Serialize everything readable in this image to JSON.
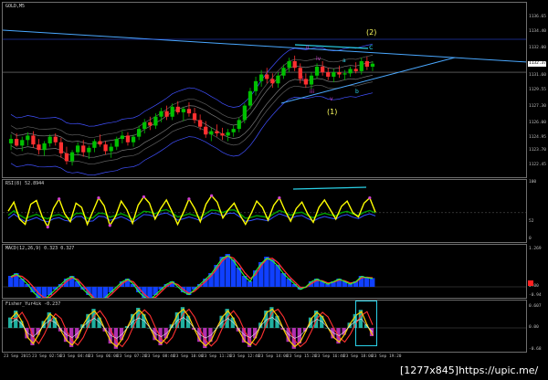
{
  "chart": {
    "symbol_title": "GOLD,M5",
    "price_scale": [
      "1136.65",
      "1134.40",
      "1132.00",
      "1131.60",
      "1129.55",
      "1127.30",
      "1126.00",
      "1124.95",
      "1123.70",
      "1122.45"
    ],
    "current_price": "1132.37",
    "wave_labels": {
      "big2": "(2)",
      "c": "c",
      "b": "b",
      "a": "a",
      "ii": "ii",
      "iii": "iii",
      "iv": "iv",
      "v": "v",
      "i": "i",
      "big1": "(1)"
    },
    "ohlc": [
      {
        "t": 0,
        "o": 1125.2,
        "h": 1126.0,
        "l": 1124.6,
        "c": 1125.6
      },
      {
        "t": 1,
        "o": 1125.6,
        "h": 1126.1,
        "l": 1124.9,
        "c": 1125.0
      },
      {
        "t": 2,
        "o": 1125.0,
        "h": 1125.8,
        "l": 1124.5,
        "c": 1125.5
      },
      {
        "t": 3,
        "o": 1125.5,
        "h": 1126.2,
        "l": 1125.0,
        "c": 1125.9
      },
      {
        "t": 4,
        "o": 1125.9,
        "h": 1126.3,
        "l": 1124.8,
        "c": 1125.1
      },
      {
        "t": 5,
        "o": 1125.1,
        "h": 1125.6,
        "l": 1124.2,
        "c": 1124.6
      },
      {
        "t": 6,
        "o": 1124.6,
        "h": 1125.4,
        "l": 1124.1,
        "c": 1125.2
      },
      {
        "t": 7,
        "o": 1125.2,
        "h": 1126.0,
        "l": 1124.9,
        "c": 1125.8
      },
      {
        "t": 8,
        "o": 1125.8,
        "h": 1126.1,
        "l": 1125.0,
        "c": 1125.3
      },
      {
        "t": 9,
        "o": 1125.3,
        "h": 1125.7,
        "l": 1123.9,
        "c": 1124.3
      },
      {
        "t": 10,
        "o": 1124.3,
        "h": 1124.9,
        "l": 1123.3,
        "c": 1123.6
      },
      {
        "t": 11,
        "o": 1123.6,
        "h": 1124.6,
        "l": 1123.2,
        "c": 1124.4
      },
      {
        "t": 12,
        "o": 1124.4,
        "h": 1125.3,
        "l": 1124.1,
        "c": 1125.0
      },
      {
        "t": 13,
        "o": 1125.0,
        "h": 1125.5,
        "l": 1124.0,
        "c": 1124.4
      },
      {
        "t": 14,
        "o": 1124.4,
        "h": 1125.0,
        "l": 1123.8,
        "c": 1124.8
      },
      {
        "t": 15,
        "o": 1124.8,
        "h": 1125.6,
        "l": 1124.4,
        "c": 1125.4
      },
      {
        "t": 16,
        "o": 1125.4,
        "h": 1126.0,
        "l": 1124.9,
        "c": 1125.1
      },
      {
        "t": 17,
        "o": 1125.1,
        "h": 1125.4,
        "l": 1124.2,
        "c": 1124.5
      },
      {
        "t": 18,
        "o": 1124.5,
        "h": 1125.2,
        "l": 1123.9,
        "c": 1124.9
      },
      {
        "t": 19,
        "o": 1124.9,
        "h": 1125.8,
        "l": 1124.6,
        "c": 1125.6
      },
      {
        "t": 20,
        "o": 1125.6,
        "h": 1126.3,
        "l": 1125.2,
        "c": 1125.9
      },
      {
        "t": 21,
        "o": 1125.9,
        "h": 1126.2,
        "l": 1125.0,
        "c": 1125.3
      },
      {
        "t": 22,
        "o": 1125.3,
        "h": 1126.0,
        "l": 1124.9,
        "c": 1125.8
      },
      {
        "t": 23,
        "o": 1125.8,
        "h": 1126.8,
        "l": 1125.5,
        "c": 1126.5
      },
      {
        "t": 24,
        "o": 1126.5,
        "h": 1127.4,
        "l": 1126.1,
        "c": 1127.1
      },
      {
        "t": 25,
        "o": 1127.1,
        "h": 1127.6,
        "l": 1126.4,
        "c": 1126.8
      },
      {
        "t": 26,
        "o": 1126.8,
        "h": 1127.9,
        "l": 1126.5,
        "c": 1127.6
      },
      {
        "t": 27,
        "o": 1127.6,
        "h": 1128.4,
        "l": 1127.1,
        "c": 1128.1
      },
      {
        "t": 28,
        "o": 1128.1,
        "h": 1128.6,
        "l": 1127.3,
        "c": 1127.6
      },
      {
        "t": 29,
        "o": 1127.6,
        "h": 1128.8,
        "l": 1127.3,
        "c": 1128.5
      },
      {
        "t": 30,
        "o": 1128.5,
        "h": 1129.0,
        "l": 1127.8,
        "c": 1128.0
      },
      {
        "t": 31,
        "o": 1128.0,
        "h": 1128.5,
        "l": 1127.2,
        "c": 1128.3
      },
      {
        "t": 32,
        "o": 1128.3,
        "h": 1128.9,
        "l": 1127.6,
        "c": 1127.9
      },
      {
        "t": 33,
        "o": 1127.9,
        "h": 1128.4,
        "l": 1127.0,
        "c": 1127.3
      },
      {
        "t": 34,
        "o": 1127.3,
        "h": 1127.8,
        "l": 1126.4,
        "c": 1126.7
      },
      {
        "t": 35,
        "o": 1126.7,
        "h": 1127.2,
        "l": 1125.7,
        "c": 1126.0
      },
      {
        "t": 36,
        "o": 1126.0,
        "h": 1126.6,
        "l": 1125.4,
        "c": 1126.3
      },
      {
        "t": 37,
        "o": 1126.3,
        "h": 1126.9,
        "l": 1125.8,
        "c": 1126.1
      },
      {
        "t": 38,
        "o": 1126.1,
        "h": 1126.6,
        "l": 1125.5,
        "c": 1125.9
      },
      {
        "t": 39,
        "o": 1125.9,
        "h": 1126.5,
        "l": 1125.4,
        "c": 1126.2
      },
      {
        "t": 40,
        "o": 1126.2,
        "h": 1126.8,
        "l": 1125.8,
        "c": 1126.5
      },
      {
        "t": 41,
        "o": 1126.5,
        "h": 1127.5,
        "l": 1126.2,
        "c": 1127.3
      },
      {
        "t": 42,
        "o": 1127.3,
        "h": 1128.8,
        "l": 1127.0,
        "c": 1128.6
      },
      {
        "t": 43,
        "o": 1128.6,
        "h": 1130.2,
        "l": 1128.3,
        "c": 1129.9
      },
      {
        "t": 44,
        "o": 1129.9,
        "h": 1131.2,
        "l": 1129.5,
        "c": 1130.8
      },
      {
        "t": 45,
        "o": 1130.8,
        "h": 1131.8,
        "l": 1130.3,
        "c": 1131.4
      },
      {
        "t": 46,
        "o": 1131.4,
        "h": 1132.0,
        "l": 1130.6,
        "c": 1131.0
      },
      {
        "t": 47,
        "o": 1131.0,
        "h": 1131.5,
        "l": 1130.2,
        "c": 1130.6
      },
      {
        "t": 48,
        "o": 1130.6,
        "h": 1131.6,
        "l": 1130.2,
        "c": 1131.3
      },
      {
        "t": 49,
        "o": 1131.3,
        "h": 1132.3,
        "l": 1131.0,
        "c": 1132.0
      },
      {
        "t": 50,
        "o": 1132.0,
        "h": 1132.9,
        "l": 1131.6,
        "c": 1132.6
      },
      {
        "t": 51,
        "o": 1132.6,
        "h": 1133.1,
        "l": 1131.7,
        "c": 1132.0
      },
      {
        "t": 52,
        "o": 1132.0,
        "h": 1132.4,
        "l": 1130.6,
        "c": 1131.0
      },
      {
        "t": 53,
        "o": 1131.0,
        "h": 1131.5,
        "l": 1130.2,
        "c": 1130.5
      },
      {
        "t": 54,
        "o": 1130.5,
        "h": 1131.6,
        "l": 1130.1,
        "c": 1131.3
      },
      {
        "t": 55,
        "o": 1131.3,
        "h": 1132.4,
        "l": 1131.0,
        "c": 1132.1
      },
      {
        "t": 56,
        "o": 1132.1,
        "h": 1132.6,
        "l": 1131.3,
        "c": 1131.6
      },
      {
        "t": 57,
        "o": 1131.6,
        "h": 1132.0,
        "l": 1130.9,
        "c": 1131.2
      },
      {
        "t": 58,
        "o": 1131.2,
        "h": 1131.9,
        "l": 1130.7,
        "c": 1131.6
      },
      {
        "t": 59,
        "o": 1131.6,
        "h": 1132.2,
        "l": 1131.1,
        "c": 1131.4
      },
      {
        "t": 60,
        "o": 1131.4,
        "h": 1131.8,
        "l": 1130.9,
        "c": 1131.5
      },
      {
        "t": 61,
        "o": 1131.5,
        "h": 1132.1,
        "l": 1131.2,
        "c": 1131.9
      },
      {
        "t": 62,
        "o": 1131.9,
        "h": 1132.5,
        "l": 1131.5,
        "c": 1131.7
      },
      {
        "t": 63,
        "o": 1131.7,
        "h": 1132.9,
        "l": 1131.4,
        "c": 1132.6
      },
      {
        "t": 64,
        "o": 1132.6,
        "h": 1133.0,
        "l": 1131.8,
        "c": 1132.1
      },
      {
        "t": 65,
        "o": 1132.1,
        "h": 1132.6,
        "l": 1131.7,
        "c": 1132.37
      }
    ]
  },
  "rsi": {
    "title": "RSI(8) 52.8944",
    "scale": [
      "100",
      "52",
      "0"
    ],
    "values": [
      55,
      72,
      40,
      30,
      68,
      75,
      45,
      25,
      60,
      78,
      50,
      35,
      70,
      62,
      30,
      55,
      80,
      65,
      28,
      45,
      74,
      58,
      32,
      66,
      82,
      70,
      40,
      60,
      76,
      54,
      30,
      52,
      78,
      60,
      35,
      68,
      84,
      72,
      42,
      58,
      70,
      48,
      30,
      50,
      74,
      62,
      38,
      66,
      80,
      56,
      36,
      60,
      72,
      50,
      34,
      62,
      76,
      58,
      40,
      64,
      74,
      52,
      44,
      70,
      80,
      53
    ]
  },
  "macd": {
    "title": "MACD(12,26,9) 0.323 0.327",
    "scale": [
      "1.269",
      "0.00",
      "-0.94"
    ],
    "hist": [
      0.4,
      0.5,
      0.3,
      0.1,
      -0.2,
      -0.4,
      -0.5,
      -0.3,
      -0.1,
      0.1,
      0.3,
      0.4,
      0.2,
      -0.1,
      -0.3,
      -0.5,
      -0.6,
      -0.4,
      -0.2,
      0.0,
      0.2,
      0.3,
      0.1,
      -0.2,
      -0.4,
      -0.5,
      -0.3,
      -0.1,
      0.1,
      0.2,
      0.0,
      -0.2,
      -0.3,
      -0.1,
      0.1,
      0.3,
      0.5,
      0.8,
      1.1,
      1.2,
      1.0,
      0.7,
      0.4,
      0.2,
      0.6,
      0.9,
      1.1,
      1.0,
      0.8,
      0.5,
      0.3,
      0.1,
      -0.1,
      0.0,
      0.2,
      0.3,
      0.2,
      0.1,
      0.2,
      0.3,
      0.2,
      0.1,
      0.2,
      0.4,
      0.35,
      0.32
    ],
    "signal": [
      0.35,
      0.42,
      0.38,
      0.22,
      0.0,
      -0.25,
      -0.4,
      -0.38,
      -0.2,
      0.0,
      0.2,
      0.33,
      0.27,
      0.05,
      -0.2,
      -0.42,
      -0.54,
      -0.45,
      -0.28,
      -0.08,
      0.12,
      0.25,
      0.18,
      -0.05,
      -0.28,
      -0.44,
      -0.38,
      -0.18,
      0.02,
      0.15,
      0.08,
      -0.1,
      -0.24,
      -0.16,
      0.02,
      0.2,
      0.4,
      0.66,
      0.95,
      1.12,
      1.05,
      0.82,
      0.52,
      0.3,
      0.45,
      0.78,
      1.02,
      1.04,
      0.88,
      0.62,
      0.38,
      0.18,
      -0.02,
      -0.02,
      0.12,
      0.24,
      0.22,
      0.14,
      0.17,
      0.25,
      0.22,
      0.14,
      0.17,
      0.33,
      0.35,
      0.327
    ]
  },
  "fisher": {
    "title": "Fisher_Yur4ik -0.237",
    "scale": [
      "0.607",
      "0.00",
      "-0.68"
    ],
    "values": [
      0.3,
      0.5,
      0.2,
      -0.3,
      -0.5,
      -0.2,
      0.2,
      0.45,
      0.3,
      -0.1,
      -0.4,
      -0.55,
      -0.3,
      0.1,
      0.4,
      0.55,
      0.3,
      -0.1,
      -0.45,
      -0.6,
      -0.35,
      0.05,
      0.4,
      0.58,
      0.4,
      0.0,
      -0.35,
      -0.5,
      -0.3,
      0.1,
      0.45,
      0.6,
      0.35,
      -0.05,
      -0.4,
      -0.58,
      -0.4,
      0.0,
      0.35,
      0.55,
      0.3,
      -0.1,
      -0.42,
      -0.55,
      -0.3,
      0.15,
      0.5,
      0.6,
      0.35,
      -0.05,
      -0.4,
      -0.6,
      -0.45,
      -0.1,
      0.3,
      0.5,
      0.35,
      0.0,
      -0.3,
      -0.45,
      -0.2,
      0.15,
      0.4,
      0.52,
      0.1,
      -0.237
    ]
  },
  "time_axis": [
    "23 Sep 2015",
    "23 Sep 02:50",
    "23 Sep 04:40",
    "23 Sep 06:00",
    "23 Sep 07:20",
    "23 Sep 08:40",
    "23 Sep 10:00",
    "23 Sep 11:20",
    "23 Sep 12:40",
    "23 Sep 14:00",
    "23 Sep 15:20",
    "23 Sep 16:40",
    "23 Sep 18:00",
    "23 Sep 19:20"
  ],
  "watermark": "[1277x845]https://upic.me/",
  "colors": {
    "bull": "#00c000",
    "bear": "#ff3030",
    "rsi": "#ffff00",
    "accent": "#2ad2e8",
    "wave": "#d040d0",
    "wave_big": "#ffff60",
    "hist": "#1040ff"
  }
}
